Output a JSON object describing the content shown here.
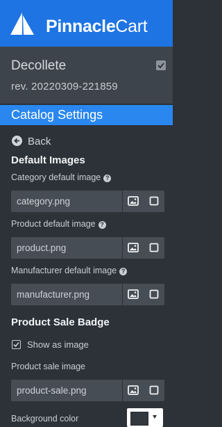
{
  "brand": {
    "name_bold": "Pinnacle",
    "name_light": "Cart",
    "color": "#1e74e3"
  },
  "theme": {
    "name": "Decollete",
    "revision": "rev. 20220309-221859",
    "active": true
  },
  "section": {
    "title": "Catalog Settings",
    "accent": "#2a87f0"
  },
  "nav": {
    "back_label": "Back",
    "back_icon": "arrow-left-circle-icon"
  },
  "default_images": {
    "heading": "Default Images",
    "fields": [
      {
        "label": "Category default image",
        "value": "category.png"
      },
      {
        "label": "Product default image",
        "value": "product.png"
      },
      {
        "label": "Manufacturer default image",
        "value": "manufacturer.png"
      }
    ],
    "help_glyph": "?",
    "picker_icon": "image-icon",
    "clear_icon": "square-icon"
  },
  "sale_badge": {
    "heading": "Product Sale Badge",
    "show_as_image": {
      "label": "Show as image",
      "checked": true
    },
    "sale_image": {
      "label": "Product sale image",
      "value": "product-sale.png"
    },
    "background": {
      "label": "Background color",
      "color": "#33383f"
    }
  }
}
